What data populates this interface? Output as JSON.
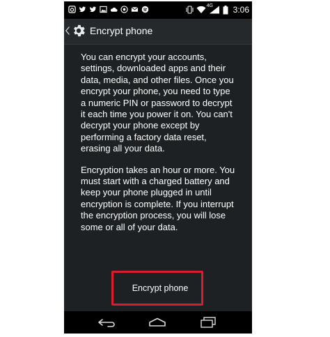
{
  "status_bar": {
    "time": "3:06",
    "network": "4G",
    "left_icons": [
      "instagram-icon",
      "twitter-icon",
      "twitter-icon",
      "photo-icon",
      "cloud-icon",
      "chrome-icon",
      "email-icon",
      "spotify-icon"
    ],
    "right_icons": [
      "vibrate-icon",
      "wifi-icon",
      "signal-icon",
      "battery-icon"
    ]
  },
  "action_bar": {
    "title": "Encrypt phone",
    "icon": "settings-gear-icon"
  },
  "content": {
    "paragraph_1": "You can encrypt your accounts, settings, downloaded apps and their data, media, and other files. Once you encrypt your phone, you need to type a numeric PIN or password to decrypt it each time you power it on. You can't decrypt your phone except by performing a factory data reset, erasing all your data.",
    "paragraph_2": "Encryption takes an hour or more. You must start with a charged battery and keep your phone plugged in until encryption is complete. If you interrupt the encryption process, you will lose some or all of your data."
  },
  "button": {
    "label": "Encrypt phone",
    "highlight_color": "#d71e2e"
  },
  "nav_bar": {
    "icons": [
      "back-icon",
      "home-icon",
      "recent-apps-icon"
    ]
  }
}
